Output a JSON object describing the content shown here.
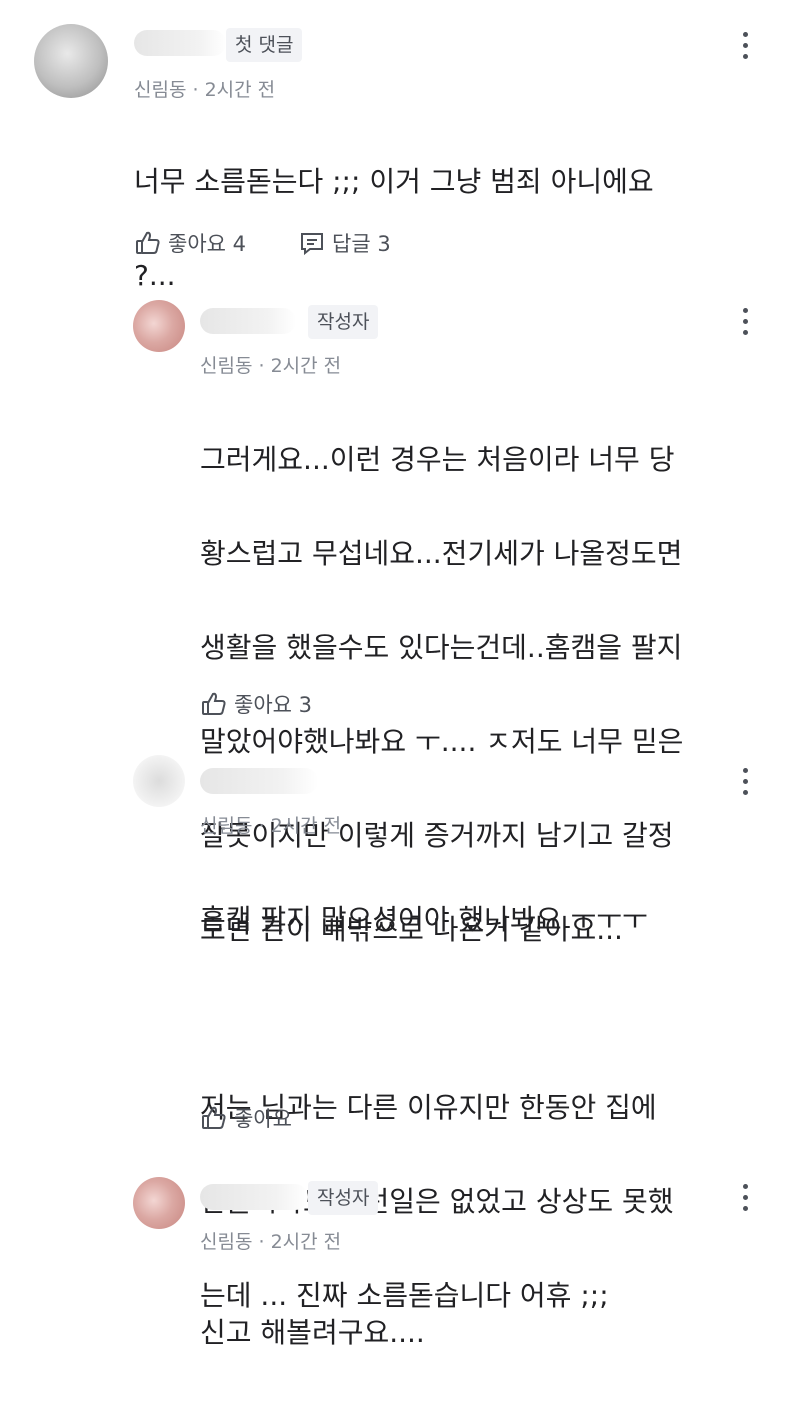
{
  "comments": [
    {
      "badge": "첫 댓글",
      "location": "신림동",
      "time": "2시간 전",
      "text_lines": [
        "너무 소름돋는다 ;;; 이거 그냥 범죄 아니에요",
        "?..."
      ],
      "like_label": "좋아요 4",
      "reply_label": "답글 3"
    },
    {
      "badge": "작성자",
      "location": "신림동",
      "time": "2시간 전",
      "text_lines": [
        "그러게요...이런 경우는 처음이라 너무 당",
        "황스럽고 무섭네요...전기세가 나올정도면",
        "생활을 했을수도 있다는건데..홈캠을 팔지",
        "말았어야했나봐요 ㅜ.... ㅈ저도 너무 믿은",
        "잘못이지만 이렇게 증거까지 남기고 갈정",
        "도면 간이 배밖으로 나온거 같아요..."
      ],
      "like_label": "좋아요 3"
    },
    {
      "location": "신림동",
      "time": "2시간 전",
      "text_lines": [
        "홈캠 팔지 말으셨어야 했나봐요 ㅜㅜㅜ",
        "",
        "저는 님과는 다른 이유지만 한동안 집에",
        "안들어와도 이런일은 없었고 상상도 못했",
        "는데 ... 진짜 소름돋습니다 어휴 ;;;"
      ],
      "like_label": "좋아요"
    },
    {
      "badge": "작성자",
      "location": "신림동",
      "time": "2시간 전",
      "text_lines": [
        "신고 해볼려구요...."
      ]
    }
  ],
  "meta_separator": "·",
  "icons": {
    "more": "more-vertical-icon",
    "like": "thumbs-up-icon",
    "reply": "reply-icon"
  }
}
